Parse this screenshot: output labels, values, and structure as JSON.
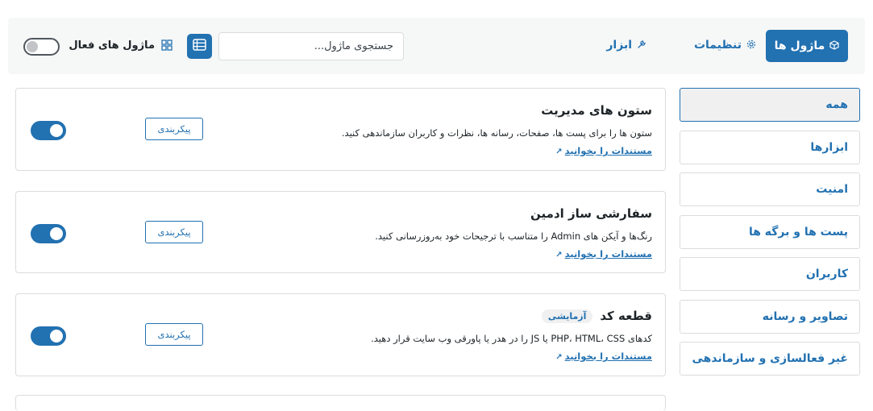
{
  "nav": {
    "modules_tab": "ماژول ها",
    "settings_tab": "تنظیمات",
    "tools_tab": "ابزار"
  },
  "toolbar": {
    "search_placeholder": "جستجوی ماژول...",
    "active_modules_label": "ماژول های فعال",
    "active_filter_enabled": false
  },
  "sidebar": {
    "items": [
      {
        "label": "همه",
        "active": true
      },
      {
        "label": "ابزارها",
        "active": false
      },
      {
        "label": "امنیت",
        "active": false
      },
      {
        "label": "پست ها و برگه ها",
        "active": false
      },
      {
        "label": "کاربران",
        "active": false
      },
      {
        "label": "تصاویر و رسانه",
        "active": false
      },
      {
        "label": "غیر فعالسازی و سازماندهی",
        "active": false
      }
    ]
  },
  "modules": [
    {
      "title": "ستون های مدیریت",
      "badge": "",
      "description": "ستون ها را برای پست ها، صفحات، رسانه ها، نظرات و کاربران سازماندهی کنید.",
      "doc_link": "مستندات را بخوانید",
      "config_label": "پیکربندی",
      "enabled": true
    },
    {
      "title": "سفارشی ساز ادمین",
      "badge": "",
      "description": "رنگ‌ها و آیکن های Admin را متناسب با ترجیحات خود به‌روزرسانی کنید.",
      "doc_link": "مستندات را بخوانید",
      "config_label": "پیکربندی",
      "enabled": true
    },
    {
      "title": "قطعه کد",
      "badge": "آزمایشی",
      "description": "کدهای PHP، HTML، CSS یا JS را در هدر یا پاورقی وب سایت قرار دهید.",
      "doc_link": "مستندات را بخوانید",
      "config_label": "پیکربندی",
      "enabled": true
    }
  ],
  "icons": {
    "modules": "cube-icon",
    "settings": "gear-icon",
    "tools": "wrench-icon",
    "list_view": "list-view-icon",
    "grid_view": "grid-view-icon",
    "doc_link": "external-arrow-icon"
  },
  "colors": {
    "accent": "#2271b1",
    "text": "#1d2327",
    "border": "#dcdcde",
    "bar_bg": "#f6f7f7"
  }
}
